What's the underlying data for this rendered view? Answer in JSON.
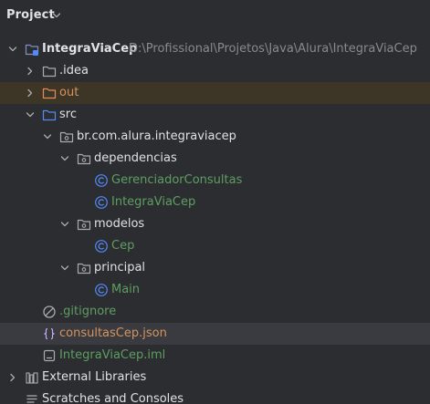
{
  "panel": {
    "title": "Project",
    "colors": {
      "background": "#2b2d30",
      "excluded_row": "#3d3627",
      "selected_row": "#393b40",
      "folder_icon": "#7e92bf",
      "source_folder_icon": "#548af7",
      "excluded_folder_icon": "#e58c56",
      "class_icon": "#548af7",
      "green_text": "#5e9e62",
      "orange_text": "#d5935d"
    }
  },
  "tree": {
    "project_root": {
      "name": "IntegraViaCep",
      "path": "D:\\Profissional\\Projetos\\Java\\Alura\\IntegraViaCep",
      "icon": "module-folder-icon"
    },
    "idea": {
      "name": ".idea",
      "icon": "folder-icon"
    },
    "out": {
      "name": "out",
      "icon": "excluded-folder-icon"
    },
    "src": {
      "name": "src",
      "icon": "source-folder-icon"
    },
    "package_root": {
      "name": "br.com.alura.integraviacep",
      "icon": "package-icon"
    },
    "pkg_dependencias": {
      "name": "dependencias",
      "icon": "package-icon"
    },
    "class_gerenciador": {
      "name": "GerenciadorConsultas",
      "icon": "class-icon"
    },
    "class_integraviacep": {
      "name": "IntegraViaCep",
      "icon": "class-icon"
    },
    "pkg_modelos": {
      "name": "modelos",
      "icon": "package-icon"
    },
    "class_cep": {
      "name": "Cep",
      "icon": "class-icon"
    },
    "pkg_principal": {
      "name": "principal",
      "icon": "package-icon"
    },
    "class_main": {
      "name": "Main",
      "icon": "class-icon"
    },
    "file_gitignore": {
      "name": ".gitignore",
      "icon": "ignore-file-icon"
    },
    "file_json": {
      "name": "consultasCep.json",
      "icon": "json-file-icon"
    },
    "file_iml": {
      "name": "IntegraViaCep.iml",
      "icon": "module-file-icon"
    },
    "external_libraries": {
      "name": "External Libraries",
      "icon": "libraries-icon"
    },
    "scratches": {
      "name": "Scratches and Consoles",
      "icon": "scratches-icon"
    }
  }
}
